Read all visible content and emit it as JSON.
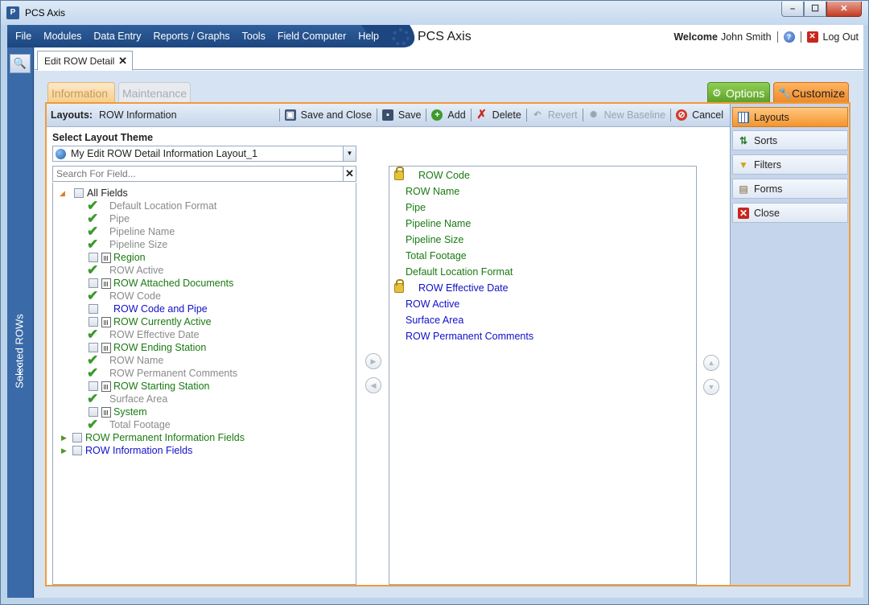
{
  "window": {
    "title": "PCS Axis",
    "app_icon": "P",
    "min": "–",
    "max": "☐",
    "close": "✕"
  },
  "menu": {
    "items": [
      "File",
      "Modules",
      "Data Entry",
      "Reports / Graphs",
      "Tools",
      "Field Computer",
      "Help"
    ],
    "brand": "PCS Axis",
    "welcome_label": "Welcome",
    "user": "John Smith",
    "logout": "Log Out",
    "logout_icon": "✕",
    "help_icon": "?"
  },
  "leftbar": {
    "label": "Selected ROWs",
    "search_icon": "🔍"
  },
  "doc_tab": {
    "label": "Edit ROW Detail",
    "close": "✕"
  },
  "tabs": {
    "information": "Information",
    "maintenance": "Maintenance",
    "options": "Options",
    "customize": "Customize",
    "options_icon": "⚙",
    "customize_icon": "🔧"
  },
  "toolbar": {
    "layouts_label": "Layouts:",
    "layouts_value": "ROW Information",
    "buttons": [
      {
        "label": "Save and Close",
        "icon": "▣"
      },
      {
        "label": "Save",
        "icon": "▪"
      },
      {
        "label": "Add",
        "icon": "+"
      },
      {
        "label": "Delete",
        "icon": "✗"
      },
      {
        "label": "Revert",
        "icon": "↶"
      },
      {
        "label": "New Baseline",
        "icon": "✺"
      },
      {
        "label": "Cancel",
        "icon": "⊘"
      }
    ]
  },
  "theme": {
    "label": "Select Layout Theme",
    "value": "My Edit ROW Detail Information Layout_1",
    "arrow": "▼"
  },
  "search": {
    "placeholder": "Search For Field...",
    "clear": "✕"
  },
  "tree": {
    "root": "All Fields",
    "expand_open": "◢",
    "expand_closed": "▶",
    "check": "✔",
    "fields": [
      {
        "label": "Default Location Format",
        "type": "check",
        "color": "gray"
      },
      {
        "label": "Pipe",
        "type": "check",
        "color": "gray"
      },
      {
        "label": "Pipeline Name",
        "type": "check",
        "color": "gray"
      },
      {
        "label": "Pipeline Size",
        "type": "check",
        "color": "gray"
      },
      {
        "label": "Region",
        "type": "box-calc",
        "color": "green"
      },
      {
        "label": "ROW Active",
        "type": "check",
        "color": "gray"
      },
      {
        "label": "ROW Attached Documents",
        "type": "box-calc",
        "color": "green"
      },
      {
        "label": "ROW Code",
        "type": "check",
        "color": "gray"
      },
      {
        "label": "ROW Code and Pipe",
        "type": "box",
        "color": "blue"
      },
      {
        "label": "ROW Currently Active",
        "type": "box-calc",
        "color": "green"
      },
      {
        "label": "ROW Effective Date",
        "type": "check",
        "color": "gray"
      },
      {
        "label": "ROW Ending Station",
        "type": "box-calc",
        "color": "green"
      },
      {
        "label": "ROW Name",
        "type": "check",
        "color": "gray"
      },
      {
        "label": "ROW Permanent Comments",
        "type": "check",
        "color": "gray"
      },
      {
        "label": "ROW Starting Station",
        "type": "box-calc",
        "color": "green"
      },
      {
        "label": "Surface Area",
        "type": "check",
        "color": "gray"
      },
      {
        "label": "System",
        "type": "box-calc",
        "color": "green"
      },
      {
        "label": "Total Footage",
        "type": "check",
        "color": "gray"
      }
    ],
    "groups": [
      {
        "label": "ROW Permanent Information Fields",
        "color": "green"
      },
      {
        "label": "ROW Information Fields",
        "color": "blue"
      }
    ]
  },
  "arrows": {
    "right": "▶",
    "left": "◀",
    "up": "▲",
    "down": "▼"
  },
  "selected_fields": [
    {
      "label": "ROW Code",
      "locked": true,
      "color": "green"
    },
    {
      "label": "ROW Name",
      "locked": false,
      "color": "green"
    },
    {
      "label": "Pipe",
      "locked": false,
      "color": "green"
    },
    {
      "label": "Pipeline Name",
      "locked": false,
      "color": "green"
    },
    {
      "label": "Pipeline Size",
      "locked": false,
      "color": "green"
    },
    {
      "label": "Total Footage",
      "locked": false,
      "color": "green"
    },
    {
      "label": "Default Location Format",
      "locked": false,
      "color": "green"
    },
    {
      "label": "ROW Effective Date",
      "locked": true,
      "color": "blue"
    },
    {
      "label": "ROW Active",
      "locked": false,
      "color": "blue"
    },
    {
      "label": "Surface Area",
      "locked": false,
      "color": "blue"
    },
    {
      "label": "ROW Permanent Comments",
      "locked": false,
      "color": "blue"
    }
  ],
  "side_panel": [
    {
      "label": "Layouts",
      "active": true
    },
    {
      "label": "Sorts",
      "active": false,
      "icon": "⇅"
    },
    {
      "label": "Filters",
      "active": false,
      "icon": "▼"
    },
    {
      "label": "Forms",
      "active": false,
      "icon": "▤"
    },
    {
      "label": "Close",
      "active": false,
      "icon": "✕"
    }
  ],
  "colors": {
    "accent_orange": "#f19a3a",
    "menu_blue": "#1d4680",
    "green_text": "#1a7a12",
    "blue_text": "#1010c8",
    "gray_text": "#8a8a8a"
  }
}
